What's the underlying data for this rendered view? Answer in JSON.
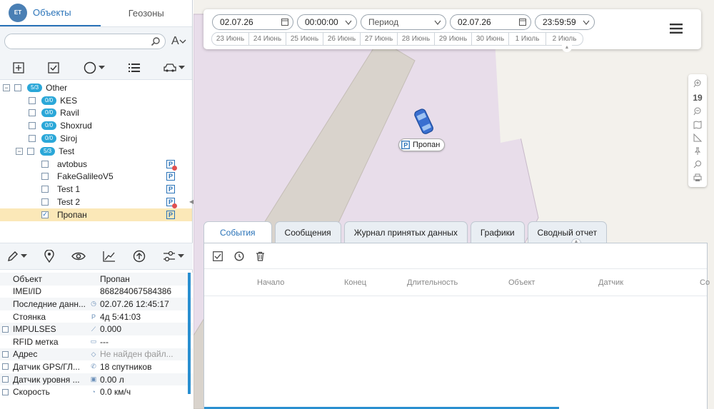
{
  "left": {
    "tabs": {
      "objects": "Объекты",
      "geozones": "Геозоны",
      "logo": "ET"
    },
    "search": {
      "value": "",
      "placeholder": ""
    },
    "font_toggle": "A",
    "tree": [
      {
        "level": 0,
        "expander": "−",
        "badge": "5/3",
        "label": "Other",
        "checked": false
      },
      {
        "level": 1,
        "badge": "0/0",
        "label": "KES",
        "checked": false
      },
      {
        "level": 1,
        "badge": "0/0",
        "label": "Ravil",
        "checked": false
      },
      {
        "level": 1,
        "badge": "0/0",
        "label": "Shoxrud",
        "checked": false
      },
      {
        "level": 1,
        "badge": "0/0",
        "label": "Siroj",
        "checked": false
      },
      {
        "level": 0,
        "expander": "−",
        "badge": "5/3",
        "label": "Test",
        "checked": false
      },
      {
        "level": 2,
        "label": "avtobus",
        "checked": false,
        "parking": true,
        "parking_alert": true
      },
      {
        "level": 2,
        "label": "FakeGalileoV5",
        "checked": false,
        "parking": true,
        "parking_alert": false
      },
      {
        "level": 2,
        "label": "Test 1",
        "checked": false,
        "parking": true,
        "parking_alert": false
      },
      {
        "level": 2,
        "label": "Test 2",
        "checked": false,
        "parking": true,
        "parking_alert": true
      },
      {
        "level": 2,
        "label": "Пропан",
        "checked": true,
        "parking": true,
        "parking_alert": false,
        "selected": true
      }
    ],
    "properties": [
      {
        "checkbox": false,
        "name": "Объект",
        "icon": "",
        "value": "Пропан"
      },
      {
        "checkbox": false,
        "name": "IMEI/ID",
        "icon": "",
        "value": "868284067584386"
      },
      {
        "checkbox": false,
        "name": "Последние данн...",
        "icon": "clock-icon",
        "value": "02.07.26 12:45:17"
      },
      {
        "checkbox": false,
        "name": "Стоянка",
        "icon": "parking-icon",
        "value": "4д 5:41:03"
      },
      {
        "checkbox": true,
        "name": "IMPULSES",
        "icon": "chart-icon",
        "value": "0.000"
      },
      {
        "checkbox": false,
        "name": "RFID метка",
        "icon": "rfid-icon",
        "value": "---"
      },
      {
        "checkbox": true,
        "name": "Адрес",
        "icon": "shield-icon",
        "value": "Не найден файл...",
        "grey": true
      },
      {
        "checkbox": true,
        "name": "Датчик GPS/ГЛ...",
        "icon": "satellite-icon",
        "value": "18 спутников"
      },
      {
        "checkbox": true,
        "name": "Датчик уровня ...",
        "icon": "fuel-icon",
        "value": "0.00 л"
      },
      {
        "checkbox": true,
        "name": "Скорость",
        "icon": "speed-icon",
        "value": "0.0 км/ч"
      }
    ]
  },
  "datebar": {
    "date_from": "02.07.26",
    "time_from": "00:00:00",
    "period": "Период",
    "date_to": "02.07.26",
    "time_to": "23:59:59",
    "days": [
      "23 Июнь",
      "24 Июнь",
      "25 Июнь",
      "26 Июнь",
      "27 Июнь",
      "28 Июнь",
      "29 Июнь",
      "30 Июнь",
      "1 Июль",
      "2 Июль"
    ]
  },
  "map": {
    "car_label": "Пропан",
    "zoom_level": "19"
  },
  "bottom": {
    "tabs": [
      "События",
      "Сообщения",
      "Журнал принятых данных",
      "Графики",
      "Сводный отчет"
    ],
    "active_tab": 0,
    "columns": [
      "Начало",
      "Конец",
      "Длительность",
      "Объект",
      "Датчик",
      "Со"
    ]
  },
  "colors": {
    "accent": "#2a73b8",
    "badge": "#2aa7d8",
    "selected_row": "#fbe8b8",
    "map_zone": "#e8ddea"
  }
}
